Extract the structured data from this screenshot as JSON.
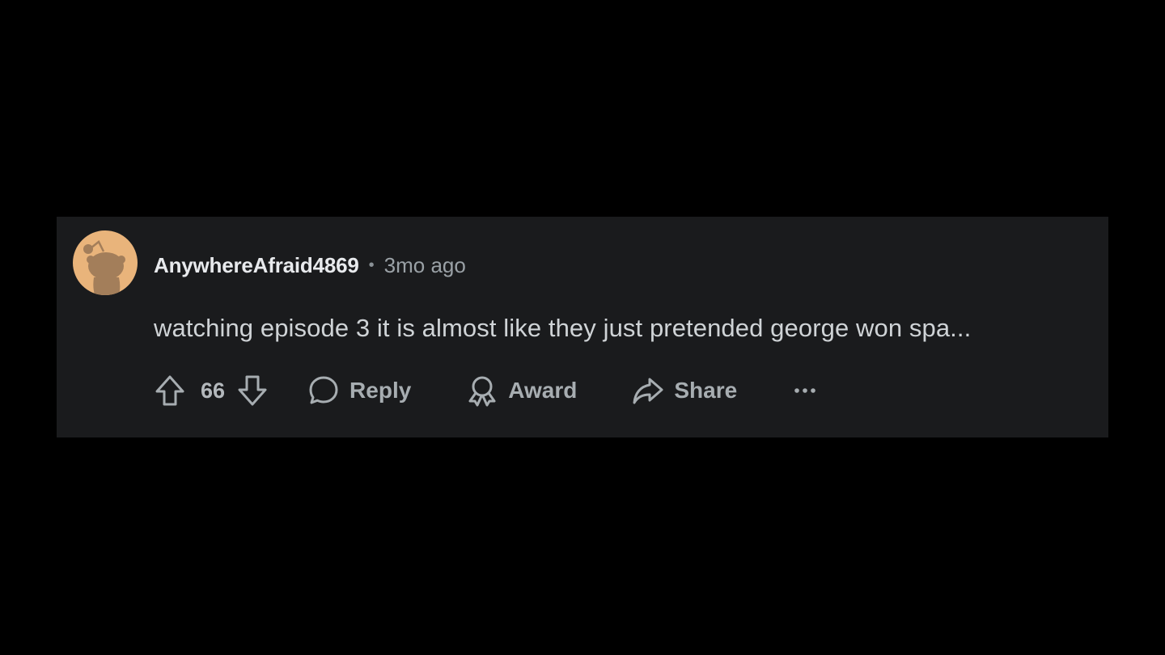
{
  "comment": {
    "author": "AnywhereAfraid4869",
    "separator": "•",
    "timestamp": "3mo ago",
    "body": "watching episode 3 it is almost like they just pretended george won spa...",
    "score": "66"
  },
  "actions": {
    "reply_label": "Reply",
    "award_label": "Award",
    "share_label": "Share"
  },
  "icons": {
    "upvote": "upvote-arrow-icon",
    "downvote": "downvote-arrow-icon",
    "reply": "speech-bubble-icon",
    "award": "award-ribbon-icon",
    "share": "share-arrow-icon",
    "more": "more-horizontal-icon"
  },
  "colors": {
    "card_background": "#1a1b1d",
    "page_background": "#000000",
    "avatar_background": "#e9b47b",
    "snoo_silhouette": "#a37e5a"
  }
}
